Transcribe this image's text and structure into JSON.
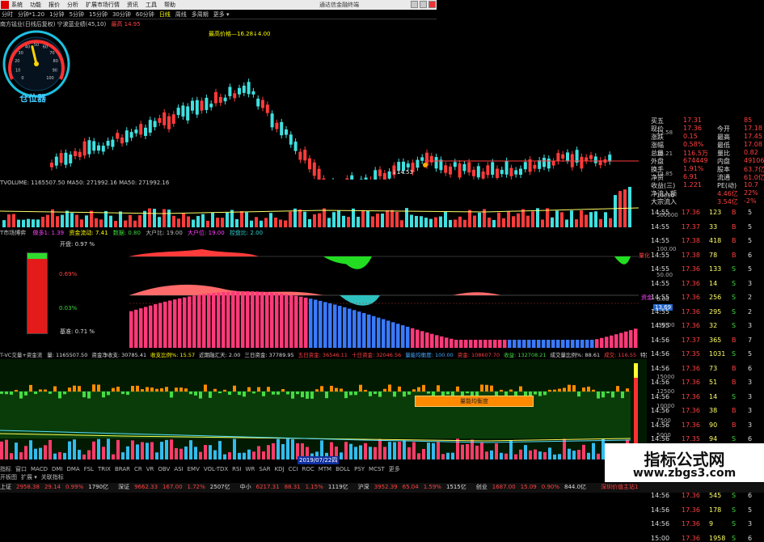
{
  "menubar": {
    "items": [
      "系统",
      "功能",
      "报价",
      "分析",
      "扩展市场行情",
      "资讯",
      "工具",
      "帮助"
    ],
    "title": "通达信金融终端"
  },
  "periods": [
    "分时",
    "分钟*1.20",
    "1分钟",
    "5分钟",
    "15分钟",
    "30分钟",
    "60分钟",
    "日线",
    "周线",
    "多周期",
    "更多 ▾"
  ],
  "active_period": "日线",
  "price_header": {
    "text": "南方锰业(日线后复权) 宁波蓝业绩(45,10)",
    "last": "最高 14.95"
  },
  "annotations": {
    "high": "最高价格—16.28↓4.00",
    "low": "↓14.53"
  },
  "gauge": {
    "label": "仓位器",
    "ticks": [
      "0",
      "10",
      "20",
      "30",
      "40",
      "50",
      "60",
      "70",
      "80",
      "90",
      "100"
    ],
    "value_pct": 45
  },
  "price_axis": [
    "15.58",
    "15.21",
    "14.85"
  ],
  "volume_header": "TVOLUME: 1165507.50  MA50: 271992.16  MA50: 271992.16",
  "volume_axis": [
    "10000",
    "500000"
  ],
  "mid_header": {
    "title": "T市场博弈",
    "items": [
      "做多1: 1.39",
      "资金流动: 7.41",
      "数据: 0.80",
      "大户比: 19.00",
      "大户位: 19.00",
      "控盘比: 2.00"
    ]
  },
  "left_indicator": {
    "top_label": "开盘:  0.97  %",
    "mid_label": "0.69%",
    "low_label": "0.03%",
    "bottom_label": "基准:  0.71  %",
    "fill_pct": 93
  },
  "mid_axis": [
    "100.00",
    "50.00",
    "0.00",
    "-50.00"
  ],
  "mid_tags": {
    "a": "量化",
    "b": "资金",
    "c": "13.69"
  },
  "bottom_header": {
    "title": "T-VC交量+资金流",
    "items": [
      "量: 1165507.50",
      "资金净收支: 30785.41",
      "收支比例%: 15.57",
      "近期融汇天: 2.00",
      "三日资金: 37789.95",
      "五日资金: 36546.11",
      "十日资金: 32046.56",
      "量能均衡度: 100.00",
      "资金: 108607.70",
      "收益: 132708.21",
      "成交量比例%: 88.61",
      "成交: 116.55",
      "特别: 116.55",
      "开盘: 13.38",
      "最新: 90.00"
    ]
  },
  "bottom_tag": "量能均衡度",
  "bottom_axis": [
    "15000",
    "12500",
    "10000",
    "7500",
    "5000",
    "2500"
  ],
  "date_label": "2019/07/22四",
  "side_summary": [
    {
      "k": "买五",
      "v": "17.31",
      "k2": "",
      "v2": "85"
    },
    {
      "k": "现价",
      "v": "17.36",
      "k2": "今开",
      "v2": "17.18"
    },
    {
      "k": "涨跌",
      "v": "0.15",
      "k2": "最高",
      "v2": "17.45"
    },
    {
      "k": "涨幅",
      "v": "0.58%",
      "k2": "最低",
      "v2": "17.08"
    },
    {
      "k": "总量",
      "v": "116.5万",
      "k2": "量比",
      "v2": "0.82"
    },
    {
      "k": "外盘",
      "v": "674449",
      "k2": "内盘",
      "v2": "491067"
    },
    {
      "k": "换手",
      "v": "1.91%",
      "k2": "股本",
      "v2": "63.7亿"
    },
    {
      "k": "净资",
      "v": "6.91",
      "k2": "流通",
      "v2": "61.0亿"
    },
    {
      "k": "收益(三)",
      "v": "1.221",
      "k2": "PE(动)",
      "v2": "10.7"
    },
    {
      "k": "净流入额",
      "v": "",
      "k2": "4.46亿",
      "v2": "22%"
    },
    {
      "k": "大宗流入",
      "v": "",
      "k2": "3.54亿",
      "v2": "-2%"
    }
  ],
  "ticks": [
    {
      "t": "14:55",
      "p": "17.36",
      "v": "123",
      "d": "B",
      "n": "5"
    },
    {
      "t": "14:55",
      "p": "17.37",
      "v": "33",
      "d": "B",
      "n": "5"
    },
    {
      "t": "14:55",
      "p": "17.38",
      "v": "418",
      "d": "B",
      "n": "5"
    },
    {
      "t": "14:55",
      "p": "17.38",
      "v": "78",
      "d": "B",
      "n": "6"
    },
    {
      "t": "14:55",
      "p": "17.36",
      "v": "133",
      "d": "S",
      "n": "5"
    },
    {
      "t": "14:55",
      "p": "17.36",
      "v": "14",
      "d": "S",
      "n": "3"
    },
    {
      "t": "14:55",
      "p": "17.36",
      "v": "256",
      "d": "S",
      "n": "2"
    },
    {
      "t": "14:55",
      "p": "17.36",
      "v": "295",
      "d": "S",
      "n": "2"
    },
    {
      "t": "14:55",
      "p": "17.36",
      "v": "32",
      "d": "S",
      "n": "3"
    },
    {
      "t": "14:56",
      "p": "17.37",
      "v": "365",
      "d": "B",
      "n": "7"
    },
    {
      "t": "14:56",
      "p": "17.35",
      "v": "1031",
      "d": "S",
      "n": "5"
    },
    {
      "t": "14:56",
      "p": "17.36",
      "v": "73",
      "d": "B",
      "n": "6"
    },
    {
      "t": "14:56",
      "p": "17.36",
      "v": "51",
      "d": "B",
      "n": "3"
    },
    {
      "t": "14:56",
      "p": "17.36",
      "v": "14",
      "d": "S",
      "n": "3"
    },
    {
      "t": "14:56",
      "p": "17.36",
      "v": "38",
      "d": "B",
      "n": "3"
    },
    {
      "t": "14:56",
      "p": "17.36",
      "v": "90",
      "d": "B",
      "n": "3"
    },
    {
      "t": "14:56",
      "p": "17.35",
      "v": "94",
      "d": "S",
      "n": "6"
    },
    {
      "t": "14:56",
      "p": "17.36",
      "v": "34",
      "d": "B",
      "n": "4"
    },
    {
      "t": "14:56",
      "p": "17.36",
      "v": "73",
      "d": "S",
      "n": "3"
    },
    {
      "t": "14:56",
      "p": "17.35",
      "v": "712",
      "d": "S",
      "n": "6"
    },
    {
      "t": "14:56",
      "p": "17.36",
      "v": "545",
      "d": "S",
      "n": "6"
    },
    {
      "t": "14:56",
      "p": "17.36",
      "v": "178",
      "d": "S",
      "n": "5"
    },
    {
      "t": "14:56",
      "p": "17.36",
      "v": "9",
      "d": "S",
      "n": "3"
    },
    {
      "t": "15:00",
      "p": "17.36",
      "v": "1958",
      "d": "S",
      "n": "6"
    }
  ],
  "indicator_tabs": [
    "指标",
    "窗口",
    "MACD",
    "DMI",
    "DMA",
    "FSL",
    "TRIX",
    "BRAR",
    "CR",
    "VR",
    "OBV",
    "ASI",
    "EMV",
    "VOL-TDX",
    "RSI",
    "WR",
    "SAR",
    "KDJ",
    "CCI",
    "ROC",
    "MTM",
    "BOLL",
    "PSY",
    "MCST",
    "更多"
  ],
  "subtabs": [
    "开板图",
    "扩展 ▾",
    "关联指标"
  ],
  "status_items": [
    {
      "label": "上证",
      "v": "2958.38",
      "c": "29.14",
      "p": "0.99%",
      "amt": "1790亿"
    },
    {
      "label": "深证",
      "v": "9662.33",
      "c": "167.00",
      "p": "1.72%",
      "amt": "2507亿"
    },
    {
      "label": "中小",
      "v": "6217.31",
      "c": "88.31",
      "p": "1.15%",
      "amt": "1119亿"
    },
    {
      "label": "沪深",
      "v": "3952.39",
      "c": "65.04",
      "p": "1.59%",
      "amt": "1515亿"
    },
    {
      "label": "创业",
      "v": "1687.00",
      "c": "15.09",
      "p": "0.90%",
      "amt": "844.0亿"
    },
    {
      "label": "",
      "v": "深圳价值主站1",
      "c": "",
      "p": "",
      "amt": ""
    }
  ],
  "watermark": {
    "line1": "指标公式网",
    "line2": "www.zbgs3.com"
  },
  "colors": {
    "up": "#ff3b3b",
    "down": "#40e0e0",
    "bg": "#000000",
    "accent": "#ffff00"
  }
}
